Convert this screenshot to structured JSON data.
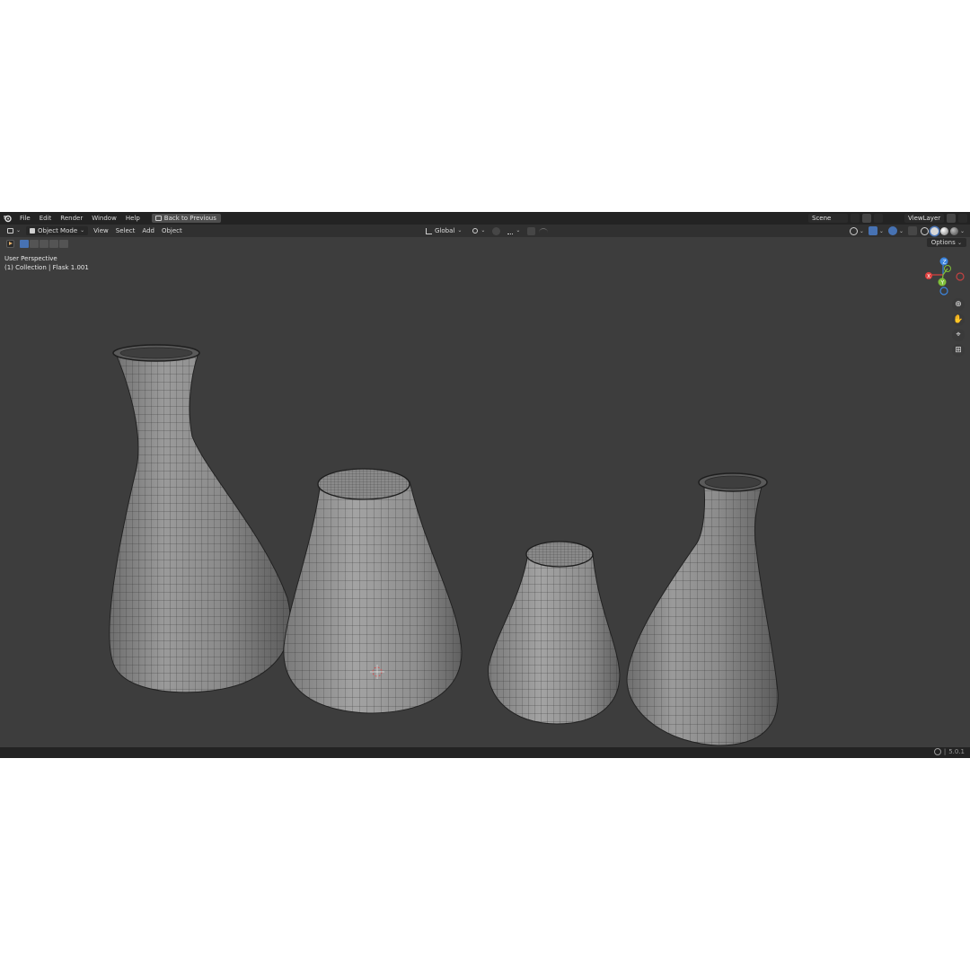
{
  "menubar": {
    "items": [
      "File",
      "Edit",
      "Render",
      "Window",
      "Help"
    ],
    "back_label": "Back to Previous",
    "scene_name": "Scene",
    "view_layer": "ViewLayer"
  },
  "header": {
    "mode": "Object Mode",
    "menus": [
      "View",
      "Select",
      "Add",
      "Object"
    ],
    "transform_orientation": "Global"
  },
  "toolbar": {
    "options_label": "Options"
  },
  "viewport": {
    "perspective_label": "User Perspective",
    "collection_label": "(1) Collection | Flask 1.001"
  },
  "gizmo": {
    "z": "Z",
    "y": "Y",
    "x": "X"
  },
  "status": {
    "version": "5.0.1"
  },
  "colors": {
    "accent": "#4772b3",
    "axis_x": "#e0413f",
    "axis_y": "#7fbf3a",
    "axis_z": "#3d86e0",
    "viewport_bg": "#3d3d3d"
  }
}
